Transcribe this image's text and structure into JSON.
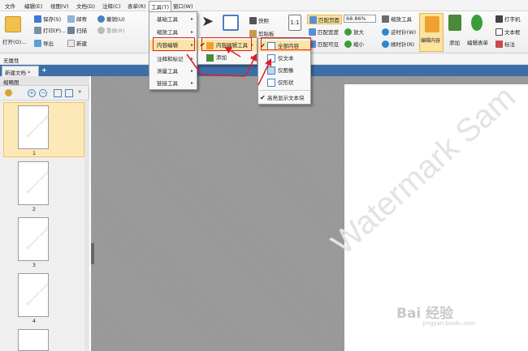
{
  "menubar": {
    "items": [
      "文件",
      "编辑(E)",
      "视图(V)",
      "文档(D)",
      "注释(C)",
      "表单(R)",
      "工具(T)",
      "窗口(W)"
    ]
  },
  "ribbon": {
    "open_label": "打开(O)...",
    "save_label": "保存(S)",
    "print_label": "打印(P)...",
    "export_label": "导出",
    "mail_label": "邮寄",
    "scan_label": "扫描",
    "new_label": "新建",
    "undo_label": "撤销(U)",
    "redo_label": "重做(R)",
    "snapshot_label": "快照",
    "clipboard_label": "剪贴板",
    "fit_page_label": "匹配页面",
    "fit_width_label": "匹配宽度",
    "fit_visible_label": "匹配可见",
    "zoom_value": "68.86%",
    "zoom_tool_label": "缩放工具",
    "zoom_in_label": "放大",
    "zoom_out_label": "缩小",
    "rotate_ccw_label": "逆时针(W)",
    "rotate_cw_label": "顺时针(R)",
    "edit_content_label": "编辑内容",
    "add_label": "添加",
    "edit_form_label": "编辑表单",
    "typewriter_label": "打字机",
    "textbox_label": "文本框",
    "note_label": "标注"
  },
  "attrbar": {
    "label": "无属性"
  },
  "tabs": {
    "doc_tab": "新建文档 *",
    "add": "+"
  },
  "thumbnails": {
    "title": "缩略图",
    "pages": [
      "1",
      "2",
      "3",
      "4"
    ],
    "watermark": "Watermark Sample"
  },
  "canvas": {
    "watermark": "Watermark Sam",
    "baidu_logo": "Bai 经验",
    "baidu_url": "jingyan.baidu.com"
  },
  "menu_tools": {
    "items": [
      "基础工具",
      "缩放工具",
      "内容编辑",
      "注释和标记",
      "测量工具",
      "链接工具"
    ]
  },
  "menu_content_edit": {
    "items": [
      "内容编辑工具",
      "添加"
    ]
  },
  "menu_content_edit_tool": {
    "items": [
      "全部内容",
      "仅文本",
      "仅图像",
      "仅形状",
      "高亮显示文本块"
    ]
  },
  "colors": {
    "accent": "#3d6ea8",
    "highlight": "#fde9b8",
    "annotation": "#e02020"
  }
}
